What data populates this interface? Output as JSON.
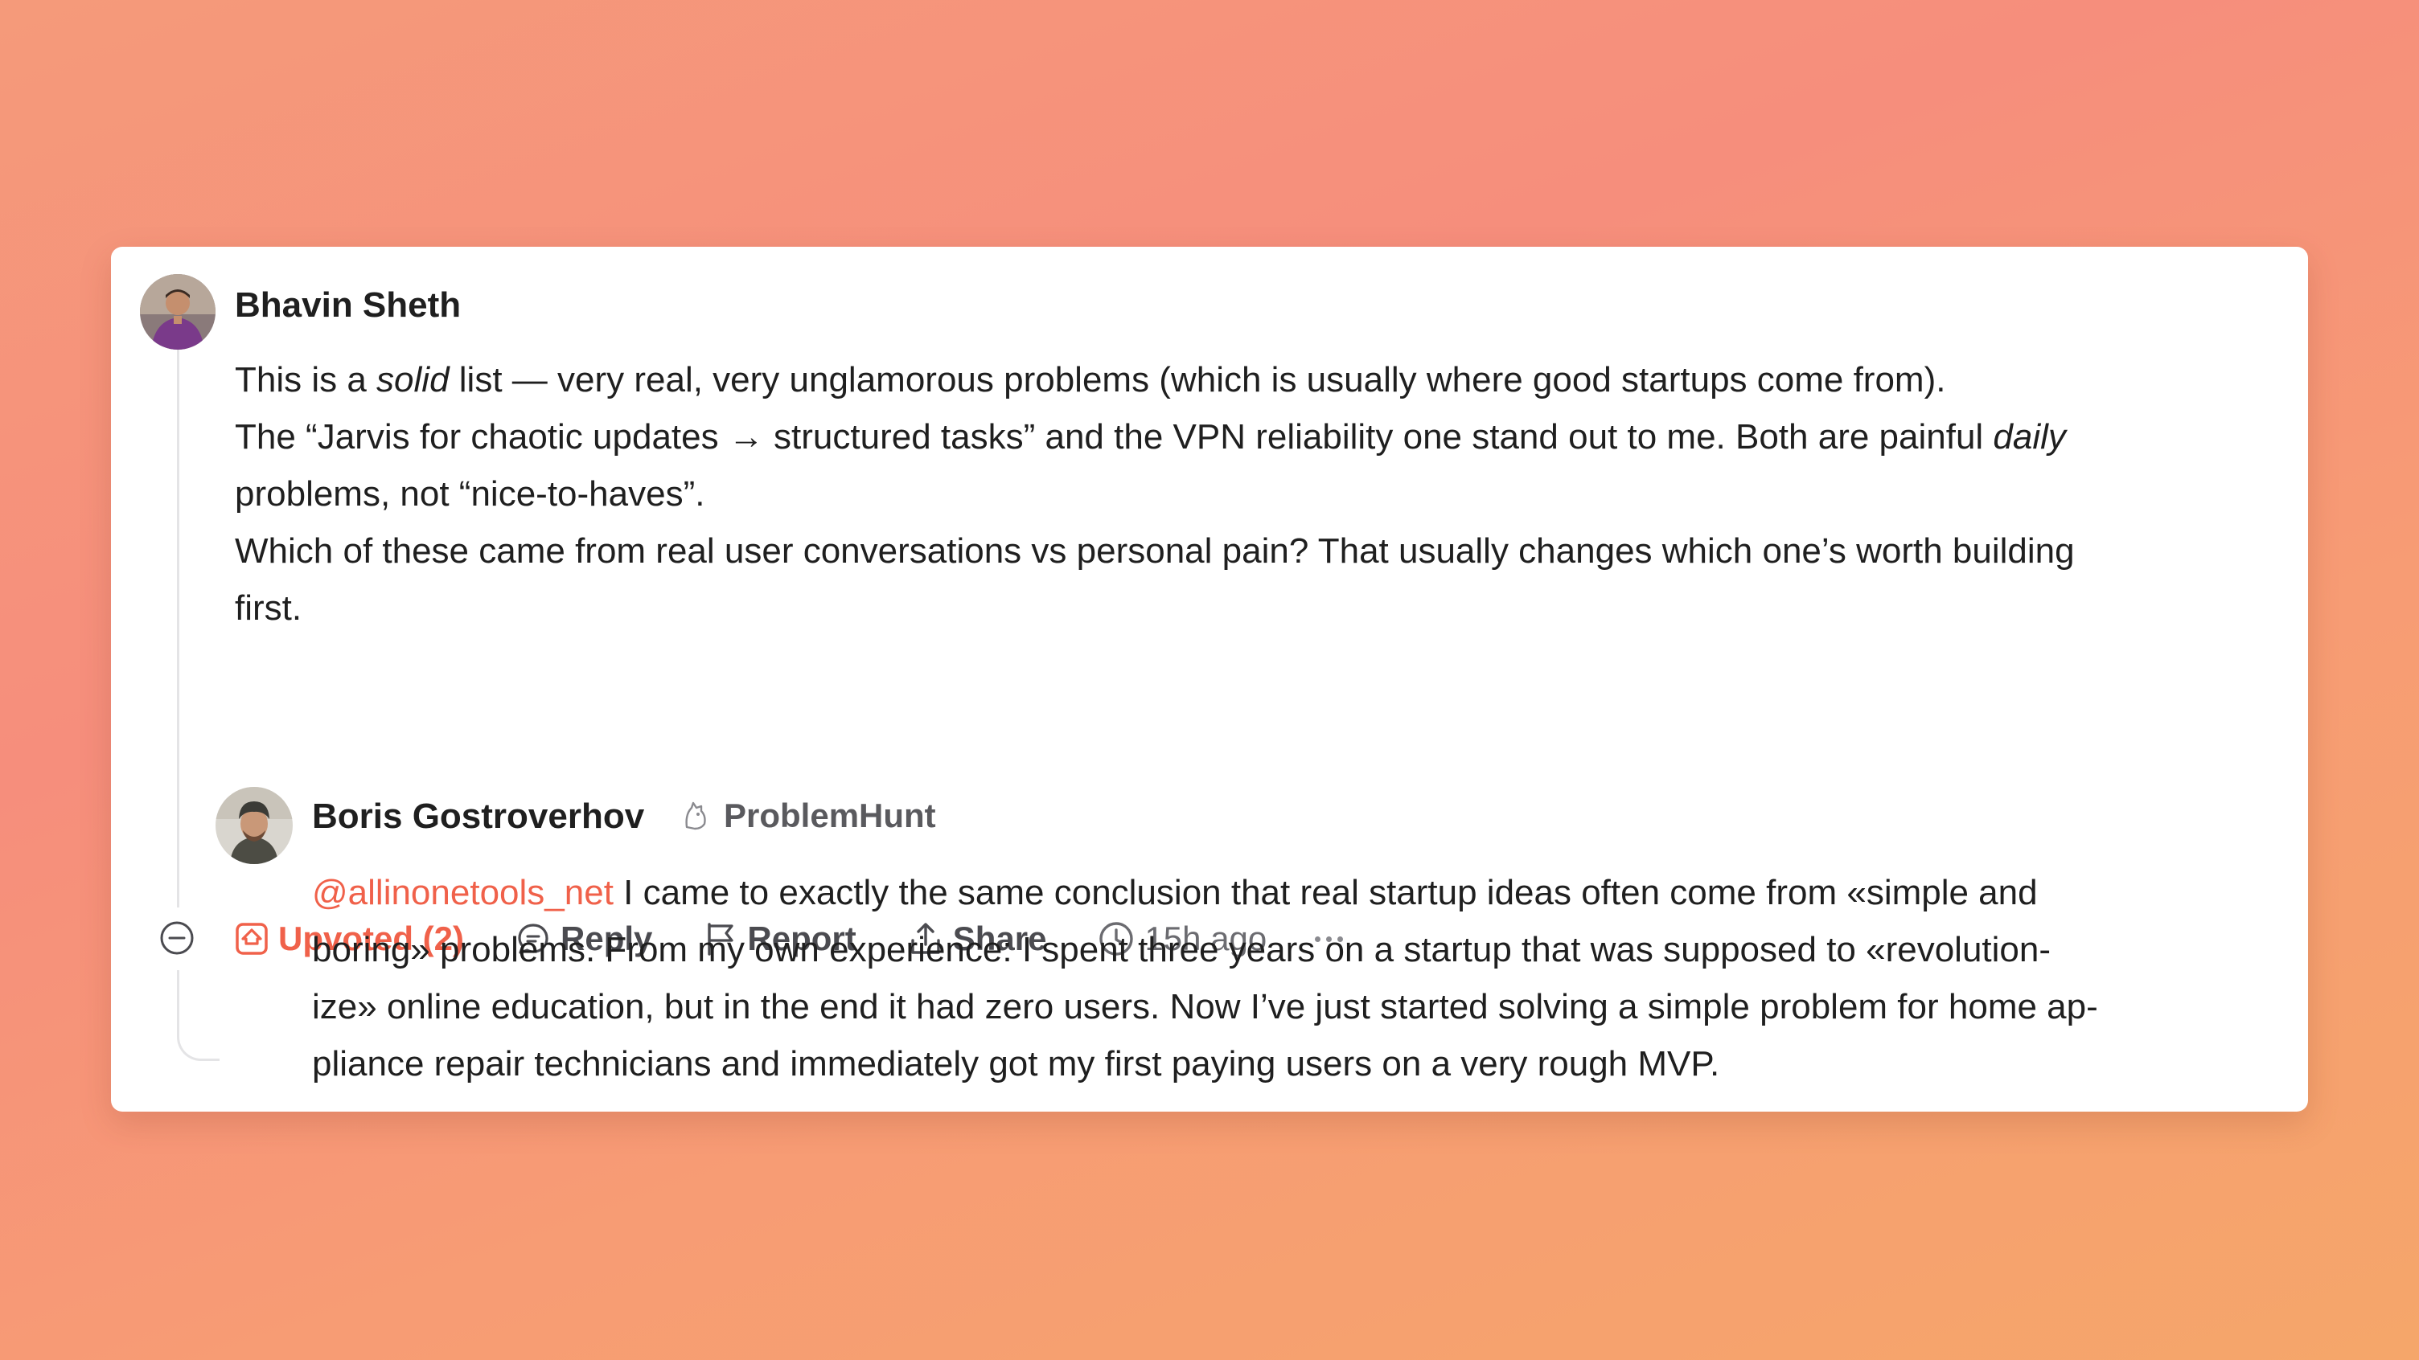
{
  "main_comment": {
    "author": "Bhavin Sheth",
    "lines": [
      [
        "This is a ",
        "solid",
        " list — very real, very unglamorous problems (which is usually where good startups come from)."
      ],
      [
        "The “Jarvis for chaotic updates → structured tasks” and the VPN reliability one stand out to me. Both are painful ",
        "daily",
        ""
      ],
      [
        "problems, not “nice-to-haves”.",
        "",
        ""
      ],
      [
        "Which of these came from real user conversations vs personal pain? That usually changes which one’s worth building",
        "",
        ""
      ],
      [
        "first.",
        "",
        ""
      ]
    ],
    "actions": {
      "upvote_label": "Upvoted (2)",
      "reply_label": "Reply",
      "report_label": "Report",
      "share_label": "Share",
      "timestamp": "15h ago"
    }
  },
  "reply_comment": {
    "author": "Boris Gostroverhov",
    "badge": "ProblemHunt",
    "mention": "@allinonetools_net",
    "line1_rest": " I came to exactly the same conclusion that real startup ideas often come from «simple and",
    "line2": "boring» problems. From my own experience: I spent three years on a startup that was supposed to «revolution-",
    "line3": "ize» online education, but in the end it had zero users. Now I’ve just started solving a simple problem for home ap-",
    "line4": "pliance repair technicians and immediately got my first paying users on a very rough MVP."
  },
  "colors": {
    "accent": "#f0614a",
    "text": "#1f1f1f",
    "muted": "#4b4b50"
  }
}
